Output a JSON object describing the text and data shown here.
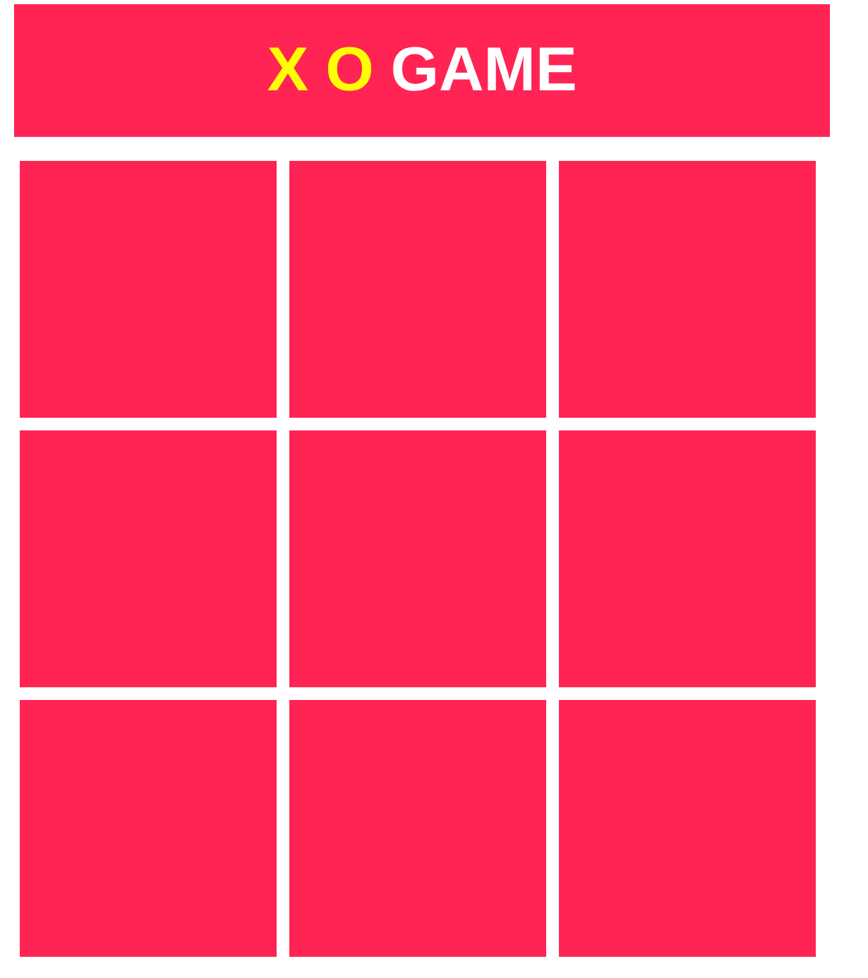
{
  "header": {
    "title_parts": [
      {
        "text": "X",
        "color": "#ffff00"
      },
      {
        "text": "O",
        "color": "#ffff00"
      },
      {
        "text": "GAME",
        "color": "#ffffff"
      }
    ]
  },
  "board": {
    "cells": [
      {
        "kind": "empty"
      },
      {
        "kind": "empty"
      },
      {
        "kind": "empty"
      },
      {
        "kind": "empty"
      },
      {
        "kind": "empty"
      },
      {
        "kind": "empty"
      },
      {
        "kind": "empty"
      },
      {
        "kind": "empty"
      },
      {
        "kind": "empty"
      }
    ]
  }
}
